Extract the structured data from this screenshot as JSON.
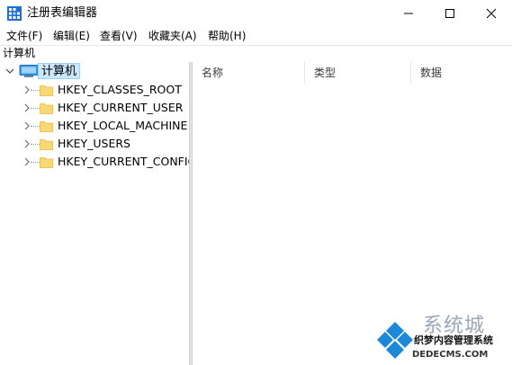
{
  "window": {
    "title": "注册表编辑器",
    "app_icon": "regedit-icon",
    "controls": {
      "minimize": "minimize-icon",
      "maximize": "maximize-icon",
      "close": "close-icon"
    }
  },
  "menu": {
    "items": [
      {
        "label": "文件(F)"
      },
      {
        "label": "编辑(E)"
      },
      {
        "label": "查看(V)"
      },
      {
        "label": "收藏夹(A)"
      },
      {
        "label": "帮助(H)"
      }
    ]
  },
  "address": {
    "path": "计算机"
  },
  "tree": {
    "root": {
      "label": "计算机",
      "icon": "computer-icon",
      "expanded": true,
      "selected": true
    },
    "keys": [
      {
        "label": "HKEY_CLASSES_ROOT",
        "icon": "folder-icon"
      },
      {
        "label": "HKEY_CURRENT_USER",
        "icon": "folder-icon"
      },
      {
        "label": "HKEY_LOCAL_MACHINE",
        "icon": "folder-icon"
      },
      {
        "label": "HKEY_USERS",
        "icon": "folder-icon"
      },
      {
        "label": "HKEY_CURRENT_CONFIG",
        "icon": "folder-icon"
      }
    ]
  },
  "list": {
    "columns": [
      {
        "label": "名称"
      },
      {
        "label": "类型"
      },
      {
        "label": "数据"
      }
    ]
  },
  "watermark": {
    "title": "系统城",
    "subtitle": "织梦内容管理系统",
    "url": "DEDECMS.COM",
    "colors": {
      "blue": "#1e88d8",
      "gray": "#9aa7b8"
    }
  },
  "colors": {
    "selection": "#cce8ff",
    "selection_border": "#99d1ff",
    "folder": "#f8d775"
  }
}
